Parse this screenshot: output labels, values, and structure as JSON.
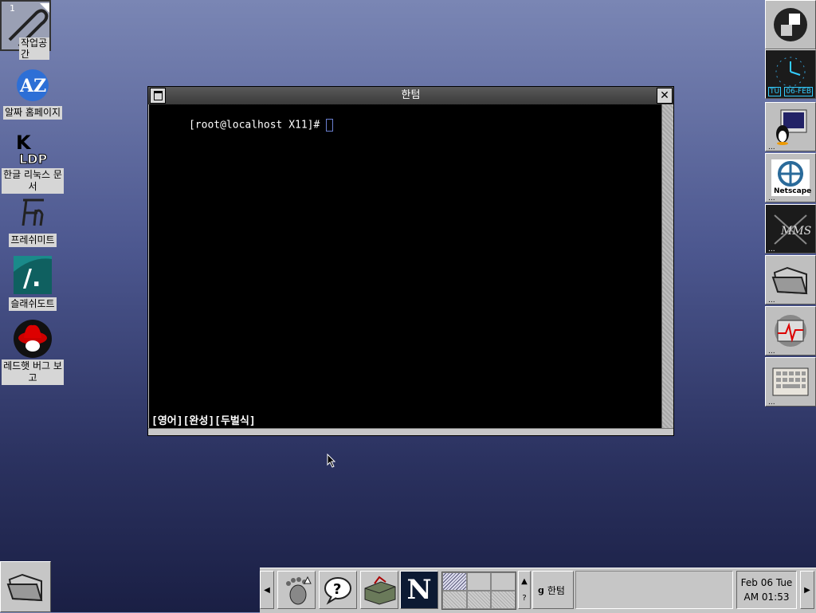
{
  "desktop": {
    "workspace_number": "1",
    "workspace_label": "작업공간",
    "icons": [
      {
        "label": "알짜 홈페이지",
        "icon": "az-icon"
      },
      {
        "label": "한글 리눅스 문서",
        "icon": "kldp-icon"
      },
      {
        "label": "프레쉬미트",
        "icon": "freshmeat-icon"
      },
      {
        "label": "슬래쉬도트",
        "icon": "slashdot-icon"
      },
      {
        "label": "레드햇 버그 보고",
        "icon": "redhat-icon"
      }
    ]
  },
  "terminal": {
    "title": "한텀",
    "prompt": "[root@localhost X11]# ",
    "status_line": "[영어][완성][두벌식]"
  },
  "dock": {
    "clock_day": "TU",
    "clock_date": "06-FEB",
    "netscape_label": "Netscape",
    "tiles": [
      "gnome-icon",
      "clock-icon",
      "tux-monitor-icon",
      "netscape-icon",
      "xmms-icon",
      "folder-icon",
      "monitor-icon",
      "keyboard-icon"
    ]
  },
  "taskbar": {
    "task_label": "한텀",
    "date": "Feb 06 Tue",
    "time": "AM 01:53",
    "help_label": "?",
    "netscape_letter": "N"
  },
  "colors": {
    "desktop_top": "#7a86b4",
    "desktop_bottom": "#1a1f44",
    "terminal_bg": "#000000"
  }
}
